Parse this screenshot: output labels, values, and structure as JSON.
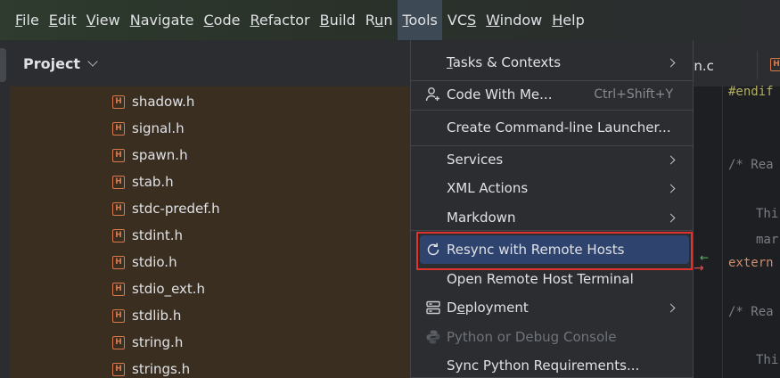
{
  "menubar": {
    "items": [
      {
        "label": "File",
        "mnemonic": "F",
        "rest": "ile"
      },
      {
        "label": "Edit",
        "mnemonic": "E",
        "rest": "dit"
      },
      {
        "label": "View",
        "mnemonic": "V",
        "rest": "iew"
      },
      {
        "label": "Navigate",
        "mnemonic": "N",
        "rest": "avigate"
      },
      {
        "label": "Code",
        "mnemonic": "C",
        "rest": "ode"
      },
      {
        "label": "Refactor",
        "mnemonic": "R",
        "rest": "efactor"
      },
      {
        "label": "Build",
        "mnemonic": "B",
        "rest": "uild"
      },
      {
        "label": "Run",
        "pre": "R",
        "mnemonic": "u",
        "rest": "n"
      },
      {
        "label": "Tools",
        "mnemonic": "T",
        "rest": "ools"
      },
      {
        "label": "VCS",
        "pre": "VC",
        "mnemonic": "S",
        "rest": ""
      },
      {
        "label": "Window",
        "mnemonic": "W",
        "rest": "indow"
      },
      {
        "label": "Help",
        "mnemonic": "H",
        "rest": "elp"
      }
    ],
    "active": "Tools"
  },
  "project": {
    "title": "Project",
    "files": [
      "shadow.h",
      "signal.h",
      "spawn.h",
      "stab.h",
      "stdc-predef.h",
      "stdint.h",
      "stdio.h",
      "stdio_ext.h",
      "stdlib.h",
      "string.h",
      "strings.h"
    ],
    "file_icon": "header-file-icon"
  },
  "editor": {
    "tab_partial": "ain.c",
    "lines": {
      "l1": "#endif",
      "l2": "/* Rea",
      "l3": "Thi",
      "l4": "mar",
      "l5": "extern",
      "l6": "/* Rea",
      "l7": "Thi"
    }
  },
  "tools_menu": {
    "items": {
      "tasks": {
        "pre": "",
        "mn": "T",
        "rest": "asks & Contexts"
      },
      "cwm": {
        "text": "Code With Me...",
        "shortcut": "Ctrl+Shift+Y"
      },
      "cli": {
        "text": "Create Command-line Launcher..."
      },
      "services": {
        "text": "Services"
      },
      "xml": {
        "text": "XML Actions"
      },
      "markdown": {
        "text": "Markdown"
      },
      "resync": {
        "text": "Resync with Remote Hosts"
      },
      "terminal": {
        "text": "Open Remote Host Terminal"
      },
      "deploy": {
        "pre": "D",
        "mn": "e",
        "rest": "ployment"
      },
      "pyconsole": {
        "text": "Python or Debug Console"
      },
      "syncreq": {
        "text": "Sync Python Requirements..."
      }
    }
  },
  "colors": {
    "highlight": "#2e436e",
    "annotation_box": "#e0332d",
    "header_icon": "#d87a4e"
  }
}
